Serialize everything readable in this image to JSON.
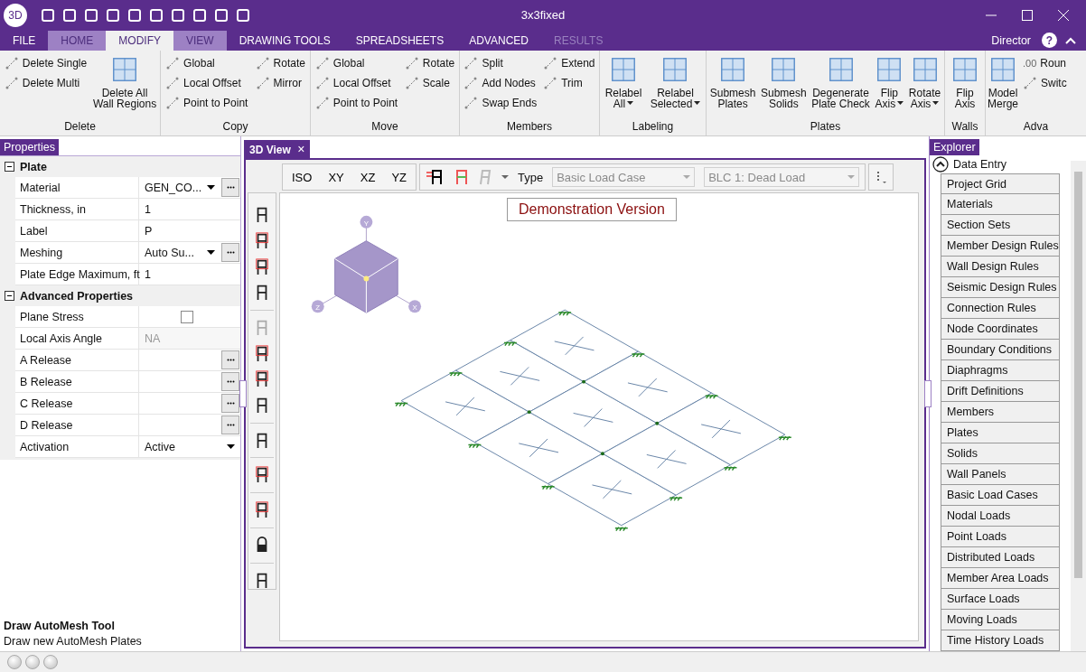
{
  "window": {
    "logo": "3D",
    "title": "3x3fixed",
    "user": "Director",
    "help": "?"
  },
  "tabs": [
    {
      "label": "FILE",
      "selected": false,
      "highlighted": false,
      "disabled": false
    },
    {
      "label": "HOME",
      "selected": false,
      "highlighted": true,
      "disabled": false
    },
    {
      "label": "MODIFY",
      "selected": true,
      "highlighted": false,
      "disabled": false
    },
    {
      "label": "VIEW",
      "selected": false,
      "highlighted": true,
      "disabled": false
    },
    {
      "label": "DRAWING TOOLS",
      "selected": false,
      "highlighted": false,
      "disabled": false
    },
    {
      "label": "SPREADSHEETS",
      "selected": false,
      "highlighted": false,
      "disabled": false
    },
    {
      "label": "ADVANCED",
      "selected": false,
      "highlighted": false,
      "disabled": false
    },
    {
      "label": "RESULTS",
      "selected": false,
      "highlighted": false,
      "disabled": true
    }
  ],
  "ribbon": {
    "groups": [
      {
        "label": "Delete",
        "items": [
          {
            "kind": "small",
            "label": "Delete Single"
          },
          {
            "kind": "small",
            "label": "Delete Multi"
          },
          {
            "kind": "large",
            "lines": [
              "Delete All",
              "Wall Regions"
            ],
            "dropdown": false
          }
        ]
      },
      {
        "label": "Copy",
        "items": [
          {
            "kind": "small",
            "label": "Global"
          },
          {
            "kind": "small",
            "label": "Local Offset"
          },
          {
            "kind": "small",
            "label": "Point to Point"
          },
          {
            "kind": "small",
            "label": "Rotate"
          },
          {
            "kind": "small",
            "label": "Mirror"
          }
        ]
      },
      {
        "label": "Move",
        "items": [
          {
            "kind": "small",
            "label": "Global"
          },
          {
            "kind": "small",
            "label": "Local Offset"
          },
          {
            "kind": "small",
            "label": "Point to Point"
          },
          {
            "kind": "small",
            "label": "Rotate"
          },
          {
            "kind": "small",
            "label": "Scale"
          }
        ]
      },
      {
        "label": "Members",
        "items": [
          {
            "kind": "small",
            "label": "Split"
          },
          {
            "kind": "small",
            "label": "Add Nodes"
          },
          {
            "kind": "small",
            "label": "Swap Ends"
          },
          {
            "kind": "small",
            "label": "Extend"
          },
          {
            "kind": "small",
            "label": "Trim"
          }
        ]
      },
      {
        "label": "Labeling",
        "items": [
          {
            "kind": "large",
            "lines": [
              "Relabel",
              "All"
            ],
            "dropdown": true
          },
          {
            "kind": "large",
            "lines": [
              "Relabel",
              "Selected"
            ],
            "dropdown": true
          }
        ]
      },
      {
        "label": "Plates",
        "items": [
          {
            "kind": "large",
            "lines": [
              "Submesh",
              "Plates"
            ],
            "dropdown": false
          },
          {
            "kind": "large",
            "lines": [
              "Submesh",
              "Solids"
            ],
            "dropdown": false
          },
          {
            "kind": "large",
            "lines": [
              "Degenerate",
              "Plate Check"
            ],
            "dropdown": false
          },
          {
            "kind": "large",
            "lines": [
              "Flip",
              "Axis"
            ],
            "dropdown": true
          },
          {
            "kind": "large",
            "lines": [
              "Rotate",
              "Axis"
            ],
            "dropdown": true
          }
        ]
      },
      {
        "label": "Walls",
        "items": [
          {
            "kind": "large",
            "lines": [
              "Flip",
              "Axis"
            ],
            "dropdown": false
          }
        ]
      },
      {
        "label": "Adva",
        "items": [
          {
            "kind": "large",
            "lines": [
              "Model",
              "Merge"
            ],
            "dropdown": false
          },
          {
            "kind": "small",
            "label": "Roun",
            "icon_text": ".00"
          },
          {
            "kind": "small",
            "label": "Switc"
          }
        ]
      }
    ]
  },
  "properties": {
    "title": "Properties",
    "sections": [
      {
        "title": "Plate",
        "expanded": true,
        "rows": [
          {
            "kind": "text",
            "label": "Material",
            "value": "GEN_CO...",
            "dropdown": true,
            "browse": true,
            "disabled": false
          },
          {
            "kind": "text",
            "label": "Thickness, in",
            "value": "1",
            "dropdown": false,
            "browse": false,
            "disabled": false
          },
          {
            "kind": "text",
            "label": "Label",
            "value": "P",
            "dropdown": false,
            "browse": false,
            "disabled": false
          },
          {
            "kind": "text",
            "label": "Meshing",
            "value": "Auto Su...",
            "dropdown": true,
            "browse": true,
            "disabled": false
          },
          {
            "kind": "text",
            "label": "Plate Edge Maximum, ft",
            "value": "1",
            "dropdown": false,
            "browse": false,
            "disabled": false
          }
        ]
      },
      {
        "title": "Advanced Properties",
        "expanded": true,
        "rows": [
          {
            "kind": "checkbox",
            "label": "Plane Stress",
            "checked": false
          },
          {
            "kind": "text",
            "label": "Local Axis Angle",
            "value": "NA",
            "dropdown": false,
            "browse": false,
            "disabled": true
          },
          {
            "kind": "text",
            "label": "A Release",
            "dropdown": false,
            "browse": true,
            "disabled": false
          },
          {
            "kind": "text",
            "label": "B Release",
            "dropdown": false,
            "browse": true,
            "disabled": false
          },
          {
            "kind": "text",
            "label": "C Release",
            "dropdown": false,
            "browse": true,
            "disabled": false
          },
          {
            "kind": "text",
            "label": "D Release",
            "dropdown": false,
            "browse": true,
            "disabled": false
          },
          {
            "kind": "text",
            "label": "Activation",
            "value": "Active",
            "dropdown": true,
            "browse": false,
            "disabled": false
          }
        ]
      }
    ],
    "help": {
      "title": "Draw AutoMesh Tool",
      "text": "Draw new AutoMesh Plates"
    }
  },
  "view": {
    "tab": "3D View",
    "close": "×",
    "view_buttons": [
      "ISO",
      "XY",
      "XZ",
      "YZ"
    ],
    "type_label": "Type",
    "load_type": {
      "value": "Basic Load Case"
    },
    "load_case": {
      "value": "BLC 1: Dead Load"
    },
    "banner": "Demonstration Version",
    "view_cube": {
      "axes": [
        "Y",
        "Z",
        "X"
      ]
    }
  },
  "explorer": {
    "title": "Explorer",
    "section": {
      "title": "Data Entry",
      "expanded": true,
      "items": [
        "Project Grid",
        "Materials",
        "Section Sets",
        "Member Design Rules",
        "Wall Design Rules",
        "Seismic Design Rules",
        "Connection Rules",
        "Node Coordinates",
        "Boundary Conditions",
        "Diaphragms",
        "Drift Definitions",
        "Members",
        "Plates",
        "Solids",
        "Wall Panels",
        "Basic Load Cases",
        "Nodal Loads",
        "Point Loads",
        "Distributed Loads",
        "Member Area Loads",
        "Surface Loads",
        "Moving Loads",
        "Time History Loads"
      ]
    }
  }
}
